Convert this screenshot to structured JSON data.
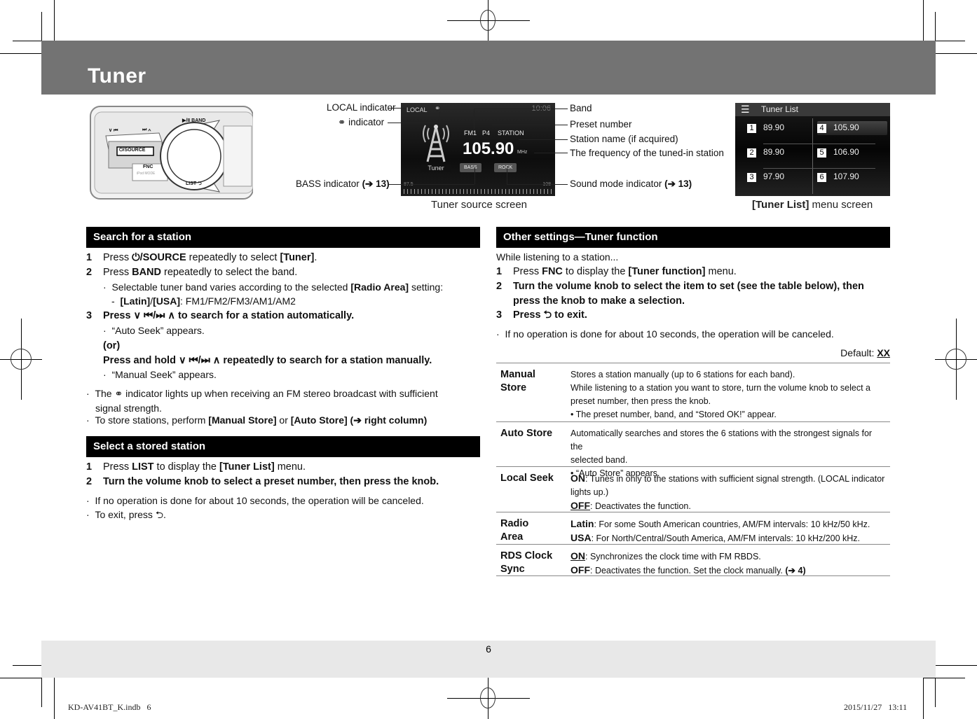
{
  "header": {
    "title": "Tuner"
  },
  "device": {
    "buttons": {
      "prev": "∨ ⏮",
      "next": "⏭ ∧",
      "source": "⏻/SOURCE",
      "fnc": "FNC",
      "fnc_sub": "iPod MODE",
      "play_band": "▶/II  BAND",
      "list": "LIST ⮌"
    }
  },
  "tuner_screen": {
    "local": "LOCAL",
    "stereo_icon": "∞",
    "clock": "10:06",
    "band": "FM1",
    "preset": "P4",
    "station": "STATION",
    "frequency": "105.90",
    "unit": "MHz",
    "source_label": "Tuner",
    "bass": "BASS",
    "sound_mode": "ROCK",
    "scale_min": "87.5",
    "scale_max": "108",
    "caption": "Tuner source screen"
  },
  "callouts": {
    "local": "LOCAL indicator",
    "stereo": "indicator",
    "bass": "BASS indicator",
    "bass_ref": "(➔ 13)",
    "band": "Band",
    "preset": "Preset number",
    "station": "Station name (if acquired)",
    "frequency": "The frequency of the tuned-in station",
    "sound_mode": "Sound mode indicator",
    "sound_ref": "(➔ 13)"
  },
  "tuner_list": {
    "title": "Tuner List",
    "caption_bold": "[Tuner List]",
    "caption_rest": " menu screen",
    "items": [
      {
        "num": "1",
        "freq": "89.90"
      },
      {
        "num": "2",
        "freq": "89.90"
      },
      {
        "num": "3",
        "freq": "97.90"
      },
      {
        "num": "4",
        "freq": "105.90"
      },
      {
        "num": "5",
        "freq": "106.90"
      },
      {
        "num": "6",
        "freq": "107.90"
      }
    ],
    "selected": "4"
  },
  "search": {
    "title": "Search for a station",
    "step1": {
      "num": "1",
      "a": "Press ",
      "b": "⏻/SOURCE",
      "c": " repeatedly to select ",
      "d": "[Tuner]",
      "e": "."
    },
    "step2": {
      "num": "2",
      "a": "Press ",
      "b": "BAND",
      "c": " repeatedly to select the band."
    },
    "step2_note": {
      "a": "Selectable tuner band varies according to the selected ",
      "b": "[Radio Area]",
      "c": " setting:"
    },
    "step2_sub": {
      "a": "[Latin]",
      "b": "/",
      "c": "[USA]",
      "d": ": FM1/FM2/FM3/AM1/AM2"
    },
    "step3": {
      "num": "3",
      "a": "Press ∨ ⏮/⏭ ∧ to search for a station automatically."
    },
    "step3_note": "“Auto Seek” appears.",
    "or": "(or)",
    "step3_alt": "Press and hold ∨ ⏮/⏭ ∧ repeatedly to search for a station manually.",
    "step3_alt_note": "“Manual Seek” appears.",
    "note1": {
      "a": "The ",
      "b": " indicator lights up when receiving an FM stereo broadcast with sufficient",
      "c": "signal strength."
    },
    "note2": {
      "a": "To store stations, perform ",
      "b": "[Manual Store]",
      "c": " or ",
      "d": "[Auto Store] (➔ right column)"
    }
  },
  "stored": {
    "title": "Select a stored station",
    "step1": {
      "num": "1",
      "a": "Press ",
      "b": "LIST",
      "c": " to display the ",
      "d": "[Tuner List]",
      "e": " menu."
    },
    "step2": {
      "num": "2",
      "a": "Turn the volume knob to select a preset number, then press the knob."
    },
    "note1": "If no operation is done for about 10 seconds, the operation will be canceled.",
    "note2": "To exit, press ⮌."
  },
  "other": {
    "title": "Other settings—Tuner function",
    "intro": "While listening to a station...",
    "step1": {
      "num": "1",
      "a": "Press ",
      "b": "FNC",
      "c": " to display the ",
      "d": "[Tuner function]",
      "e": " menu."
    },
    "step2": {
      "num": "2",
      "a": "Turn the volume knob to select the item to set (see the table below), then",
      "b": "press the knob to make a selection."
    },
    "step3": {
      "num": "3",
      "a": "Press ⮌ to exit."
    },
    "note": "If no operation is done for about 10 seconds, the operation will be canceled.",
    "default_label": "Default: ",
    "default_value": "XX"
  },
  "table": [
    {
      "key": [
        "Manual",
        "Store"
      ],
      "lines": [
        "Stores a station manually (up to 6 stations for each band).",
        "While listening to a station you want to store, turn the volume knob to select a",
        "preset number, then press the knob.",
        "•  The preset number, band, and “Stored OK!” appear."
      ]
    },
    {
      "key": [
        "Auto Store"
      ],
      "lines": [
        "Automatically searches and stores the 6 stations with the strongest signals for the",
        "selected band.",
        "•  “Auto Store” appears."
      ]
    },
    {
      "key": [
        "Local Seek"
      ],
      "opts": [
        {
          "label": "ON",
          "default": false,
          "text": ": Tunes in only to the stations with sufficient signal strength. (LOCAL indicator lights up.)"
        },
        {
          "label": "OFF",
          "default": true,
          "text": ": Deactivates the function."
        }
      ]
    },
    {
      "key": [
        "Radio",
        "Area"
      ],
      "opts": [
        {
          "label": "Latin",
          "default": false,
          "text": ": For some South American countries, AM/FM intervals: 10 kHz/50 kHz."
        },
        {
          "label": "USA",
          "default": false,
          "text": ": For North/Central/South America, AM/FM intervals: 10 kHz/200 kHz."
        }
      ]
    },
    {
      "key": [
        "RDS Clock",
        "Sync"
      ],
      "opts": [
        {
          "label": "ON",
          "default": true,
          "text": ": Synchronizes the clock time with FM RBDS."
        },
        {
          "label": "OFF",
          "default": false,
          "text": ": Deactivates the function. Set the clock manually. ",
          "ref": "(➔ 4)"
        }
      ]
    }
  ],
  "footer": {
    "page_number": "6",
    "slug_file": "KD-AV41BT_K.indb   6",
    "slug_date": "2015/11/27   13:11"
  }
}
